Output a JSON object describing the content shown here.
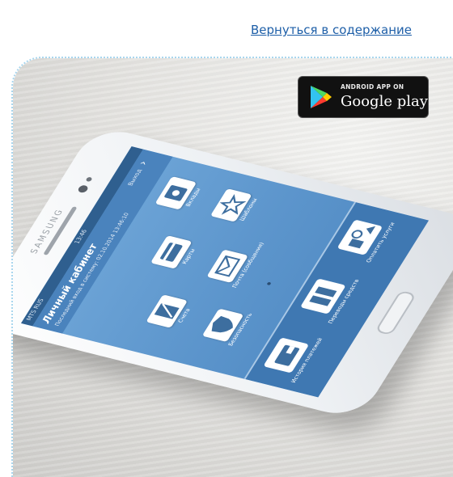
{
  "page": {
    "back_link": "Вернуться в содержание"
  },
  "badge": {
    "small_text": "ANDROID APP ON",
    "big_text": "Google play"
  },
  "phone": {
    "brand": "SAMSUNG",
    "status": {
      "carrier": "MTS RUS",
      "time": "13:46"
    },
    "screen": {
      "title": "Личный кабинет",
      "subtitle": "Последний вход в систему: 02.10.2014 13:46:10",
      "logout": "Выход",
      "tiles": [
        {
          "label": "Вклады",
          "icon": "safe-icon"
        },
        {
          "label": "Карты",
          "icon": "card-icon"
        },
        {
          "label": "Шаблоны",
          "icon": "star-icon"
        },
        {
          "label": "Счета",
          "icon": "document-icon"
        },
        {
          "label": "Почта (сообщения)",
          "icon": "envelope-icon"
        },
        {
          "label": "Безопасность",
          "icon": "shield-icon"
        }
      ],
      "bottom": [
        {
          "label": "История платежей",
          "icon": "wallet-icon"
        },
        {
          "label": "Переводы средств",
          "icon": "transfer-icon"
        },
        {
          "label": "Оплатить услуги",
          "icon": "services-icon"
        }
      ]
    }
  },
  "colors": {
    "link": "#1e5fa8",
    "screen_blue": "#5c95cc",
    "frame_dots": "#a9d6ee"
  }
}
